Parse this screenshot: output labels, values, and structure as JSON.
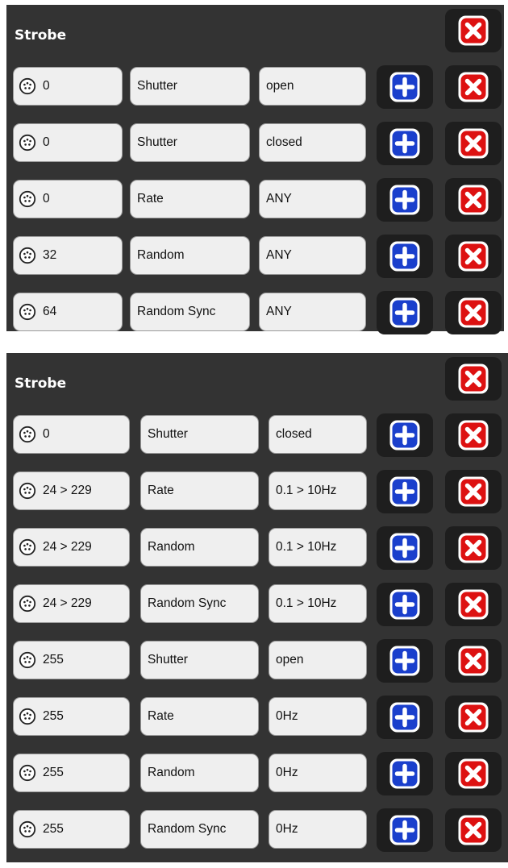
{
  "colors": {
    "panel_bg": "#333333",
    "field_bg": "#efefef",
    "add_blue": "#1a3fcc",
    "delete_red": "#dd1111"
  },
  "icons": {
    "dmx": "dmx-connector-icon",
    "add": "plus-icon",
    "delete": "close-icon"
  },
  "panels": [
    {
      "title": "Strobe",
      "rows": [
        {
          "dmx": "0",
          "param": "Shutter",
          "value": "open"
        },
        {
          "dmx": "0",
          "param": "Shutter",
          "value": "closed"
        },
        {
          "dmx": "0",
          "param": "Rate",
          "value": "ANY"
        },
        {
          "dmx": "32",
          "param": "Random",
          "value": "ANY"
        },
        {
          "dmx": "64",
          "param": "Random Sync",
          "value": "ANY"
        }
      ]
    },
    {
      "title": "Strobe",
      "rows": [
        {
          "dmx": "0",
          "param": "Shutter",
          "value": "closed"
        },
        {
          "dmx": "24 > 229",
          "param": "Rate",
          "value": "0.1 > 10Hz"
        },
        {
          "dmx": "24 > 229",
          "param": "Random",
          "value": "0.1 > 10Hz"
        },
        {
          "dmx": "24 > 229",
          "param": "Random Sync",
          "value": "0.1 > 10Hz"
        },
        {
          "dmx": "255",
          "param": "Shutter",
          "value": "open"
        },
        {
          "dmx": "255",
          "param": "Rate",
          "value": "0Hz"
        },
        {
          "dmx": "255",
          "param": "Random",
          "value": "0Hz"
        },
        {
          "dmx": "255",
          "param": "Random Sync",
          "value": "0Hz"
        }
      ]
    }
  ]
}
